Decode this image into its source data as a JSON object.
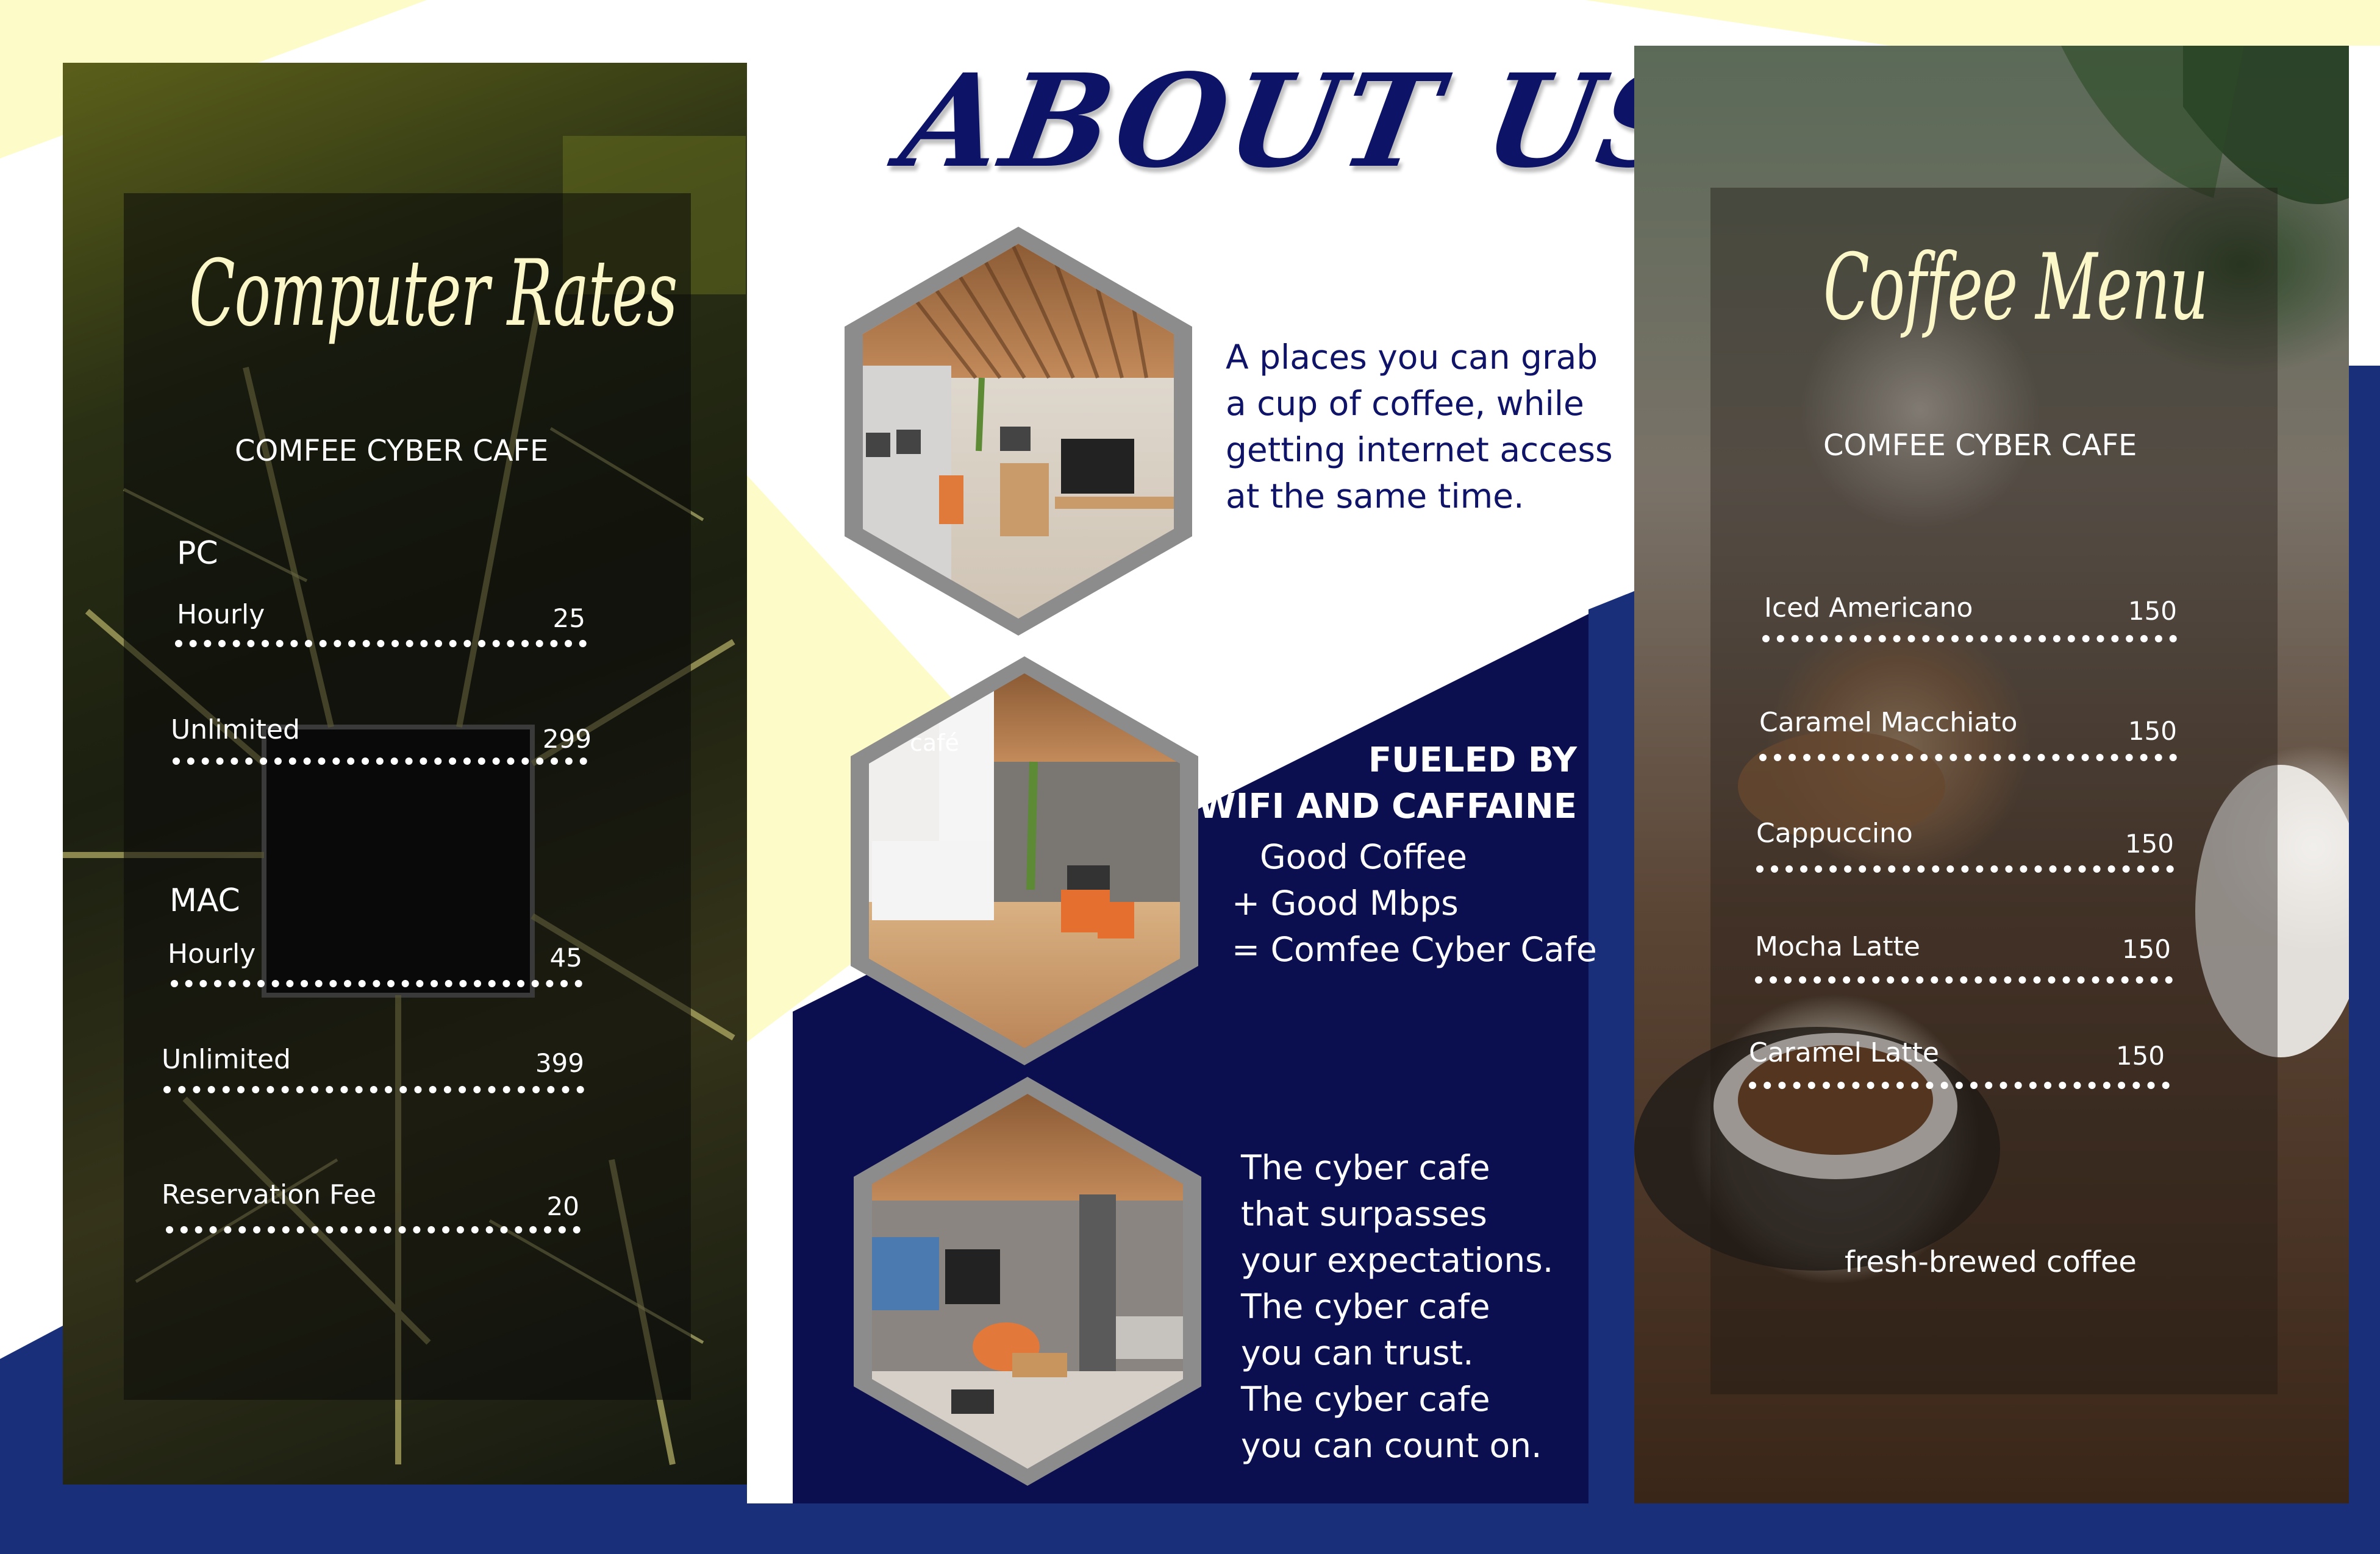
{
  "left": {
    "title": "Computer Rates",
    "subtitle": "COMFEE CYBER CAFE",
    "pc": {
      "label": "PC",
      "items": [
        {
          "label": "Hourly",
          "price": "25"
        },
        {
          "label": "Unlimited",
          "price": "299"
        }
      ]
    },
    "mac": {
      "label": "MAC",
      "items": [
        {
          "label": "Hourly",
          "price": "45"
        },
        {
          "label": "Unlimited",
          "price": "399"
        }
      ]
    },
    "reservation": {
      "label": "Reservation Fee",
      "price": "20"
    }
  },
  "center": {
    "title": "ABOUT US",
    "paragraph1": [
      "A places you can grab",
      "a cup of coffee, while",
      "getting internet access",
      "at the same time."
    ],
    "heading": [
      "FUELED BY",
      "WIFI AND CAFFAINE"
    ],
    "equation": [
      "Good Coffee",
      "+ Good Mbps",
      "= Comfee Cyber Cafe"
    ],
    "paragraph3": [
      "The cyber cafe",
      "that surpasses",
      "your expectations.",
      "The cyber cafe",
      "you can trust.",
      "The cyber cafe",
      "you can count on."
    ],
    "photo2_sign": "café"
  },
  "right": {
    "title": "Coffee Menu",
    "subtitle": "COMFEE CYBER CAFE",
    "items": [
      {
        "label": "Iced Americano",
        "price": "150"
      },
      {
        "label": "Caramel Macchiato",
        "price": "150"
      },
      {
        "label": "Cappuccino",
        "price": "150"
      },
      {
        "label": "Mocha Latte",
        "price": "150"
      },
      {
        "label": "Caramel Latte",
        "price": "150"
      }
    ],
    "tagline": "fresh-brewed coffee"
  },
  "colors": {
    "navy": "#0b0f4f",
    "royal_blue": "#1a2f7a",
    "cream": "#fdfcc8",
    "title_navy": "#0d1467",
    "script_cream": "#fbf7c8"
  }
}
